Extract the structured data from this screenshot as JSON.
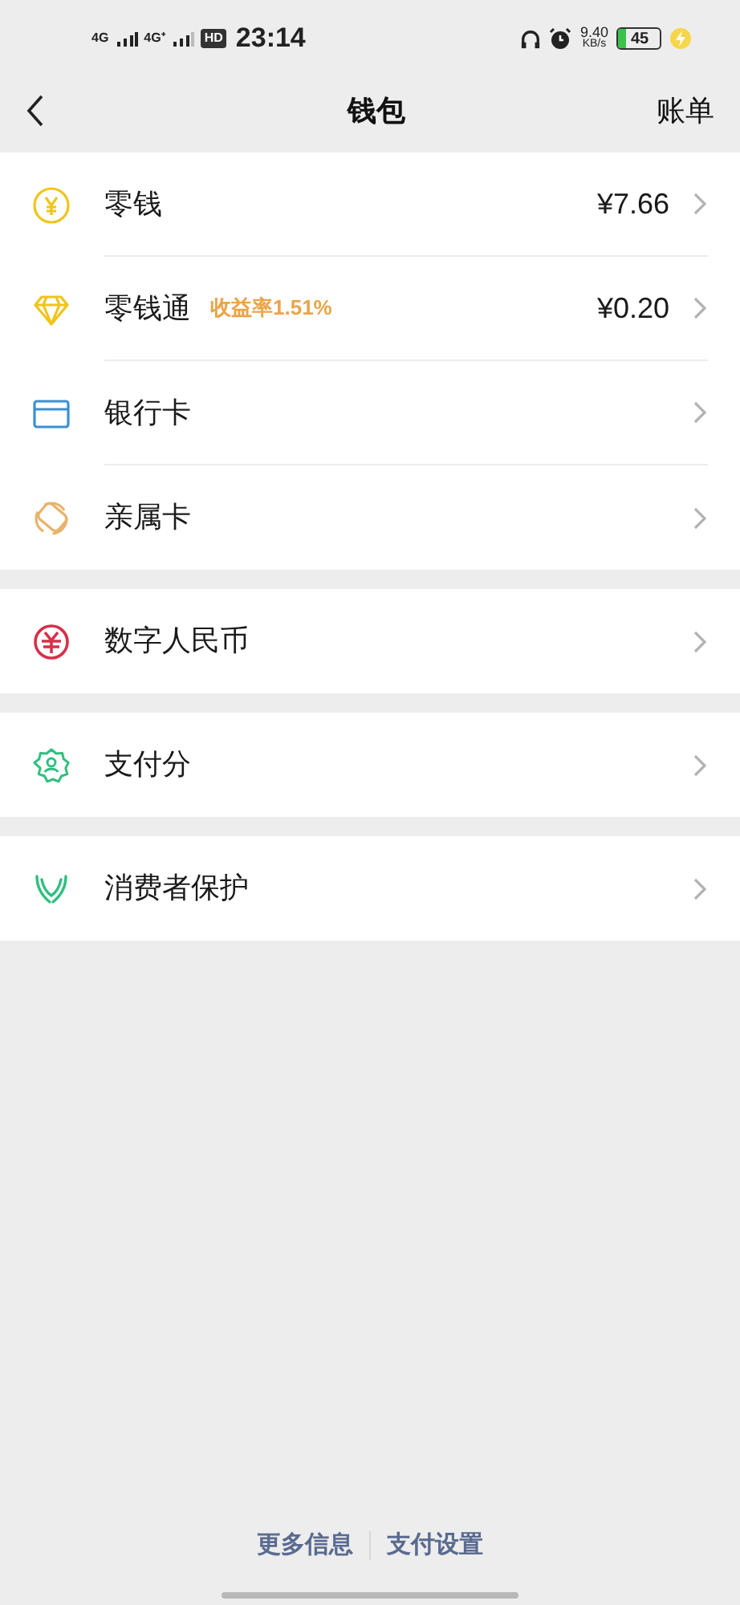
{
  "status_bar": {
    "network_1": "4G",
    "network_2": "4G⁺",
    "hd": "HD",
    "time": "23:14",
    "speed": "9.40",
    "speed_unit": "KB/s",
    "battery": "45",
    "charging": true
  },
  "nav": {
    "title": "钱包",
    "action": "账单"
  },
  "groups": [
    [
      {
        "kind": "coin",
        "label": "零钱",
        "value": "¥7.66"
      },
      {
        "kind": "diamond",
        "label": "零钱通",
        "badge": "收益率1.51%",
        "value": "¥0.20"
      },
      {
        "kind": "card",
        "label": "银行卡"
      },
      {
        "kind": "family",
        "label": "亲属卡"
      }
    ],
    [
      {
        "kind": "ecny",
        "label": "数字人民币"
      }
    ],
    [
      {
        "kind": "score",
        "label": "支付分"
      }
    ],
    [
      {
        "kind": "protect",
        "label": "消费者保护"
      }
    ]
  ],
  "footer_links": [
    "更多信息",
    "支付设置"
  ]
}
